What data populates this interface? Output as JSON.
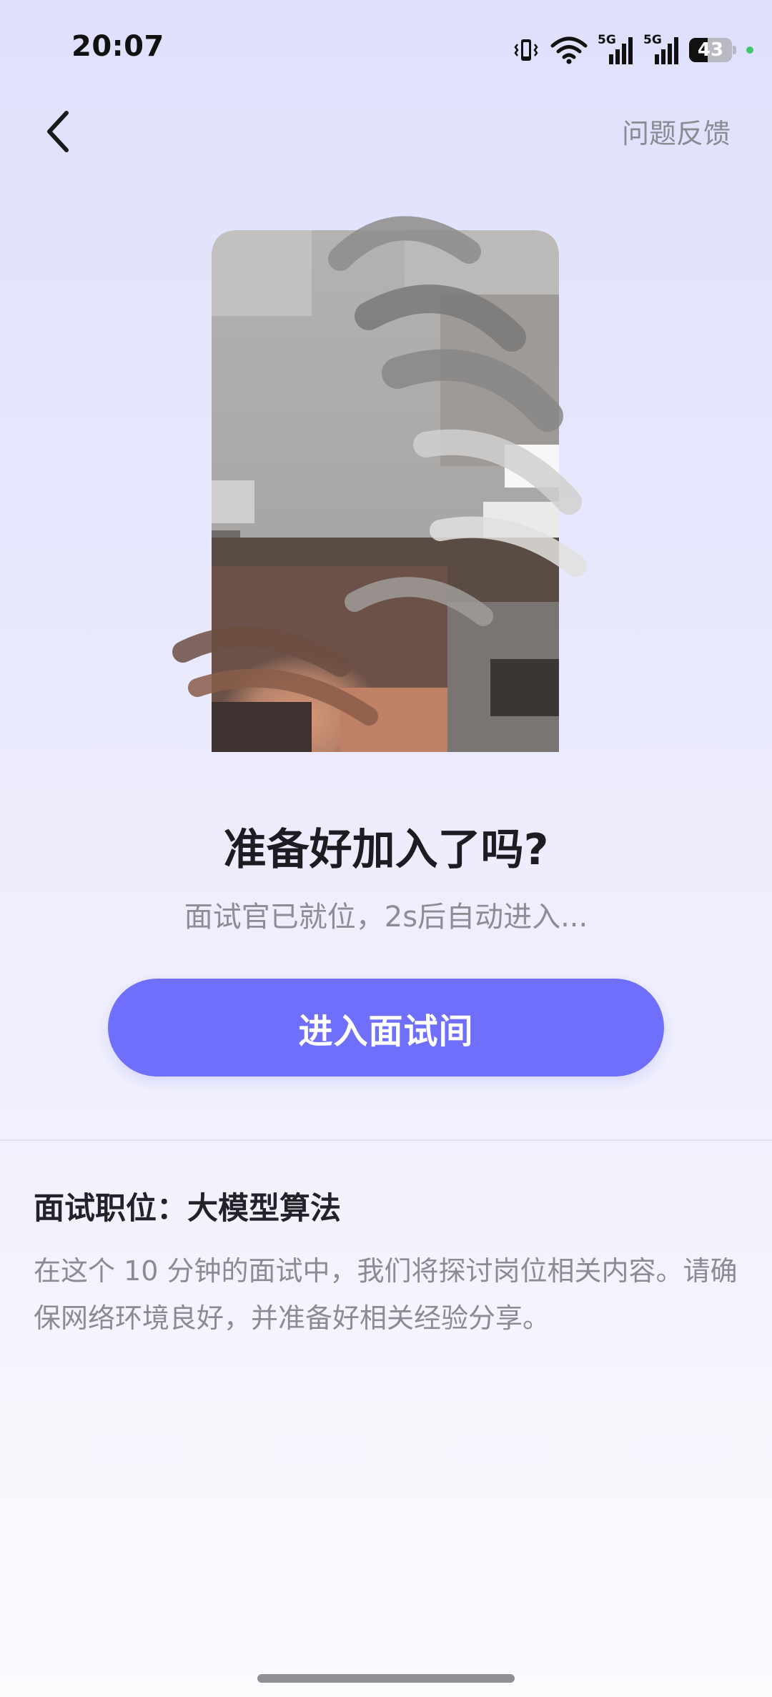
{
  "status_bar": {
    "time": "20:07",
    "battery_level": "43",
    "signal_label_1": "5G",
    "signal_label_2": "5G",
    "icons": [
      "vibrate-icon",
      "wifi-icon",
      "signal-5g-icon",
      "signal-5g-icon",
      "battery-icon",
      "privacy-dot-icon"
    ],
    "privacy_dot_color": "#3fc86a"
  },
  "nav": {
    "back_icon": "chevron-left-icon",
    "feedback_label": "问题反馈"
  },
  "camera_preview": {
    "icon": "camera-preview-image"
  },
  "prompt": {
    "title": "准备好加入了吗?",
    "subtitle": "面试官已就位，2s后自动进入..."
  },
  "enter_button": {
    "label": "进入面试间",
    "color": "#6f6ffb"
  },
  "info": {
    "position_label": "面试职位：",
    "position_value": "大模型算法",
    "description": "在这个 10 分钟的面试中，我们将探讨岗位相关内容。请确保网络环境良好，并准备好相关经验分享。"
  }
}
